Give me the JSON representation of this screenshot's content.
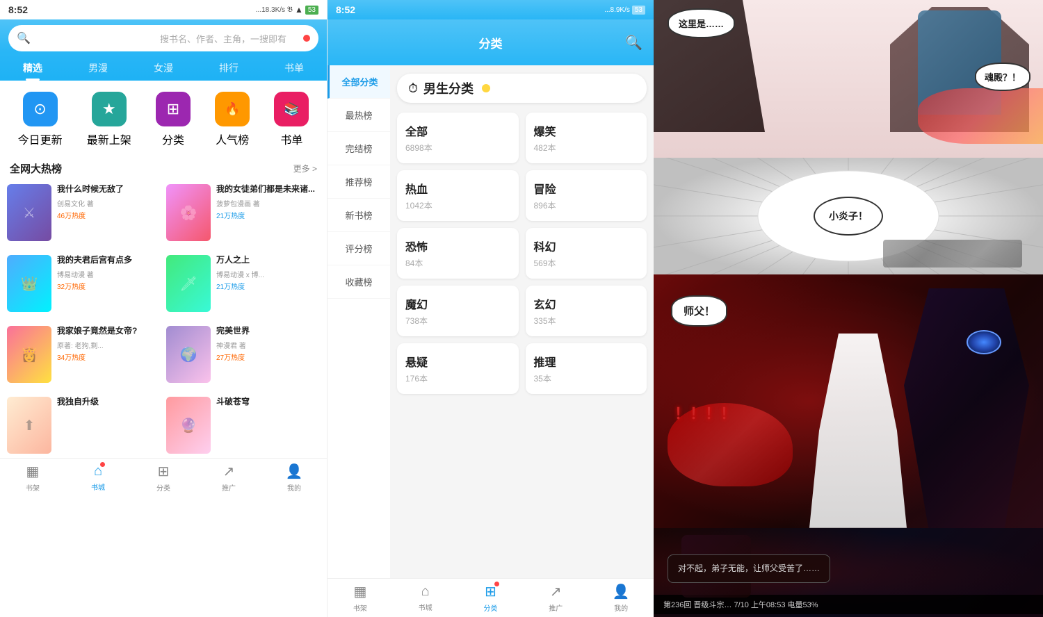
{
  "panel1": {
    "status": {
      "time": "8:52",
      "signal": "...18.3K/s",
      "battery": "53"
    },
    "search_placeholder": "搜书名、作者、主角，一搜即有",
    "nav_tabs": [
      "精选",
      "男漫",
      "女漫",
      "排行",
      "书单"
    ],
    "active_tab": "精选",
    "shortcuts": [
      {
        "label": "今日更新",
        "icon": "⊙",
        "color": "sc-blue"
      },
      {
        "label": "最新上架",
        "icon": "★",
        "color": "sc-teal"
      },
      {
        "label": "分类",
        "icon": "⊞",
        "color": "sc-purple"
      },
      {
        "label": "人气榜",
        "icon": "🔥",
        "color": "sc-orange"
      },
      {
        "label": "书单",
        "icon": "📚",
        "color": "sc-pink"
      }
    ],
    "section_title": "全网大热榜",
    "more_label": "更多 >",
    "books": [
      {
        "title": "我什么时候无敌了",
        "author": "创易文化 著",
        "heat": "46万热度",
        "cover_class": "cover-c1"
      },
      {
        "title": "我的女徒弟们都是未来诸...",
        "author": "菠萝包漫画 著",
        "heat": "21万热度",
        "cover_class": "cover-c2"
      },
      {
        "title": "我的夫君后宫有点多",
        "author": "博易动漫 著",
        "heat": "32万热度",
        "cover_class": "cover-c3"
      },
      {
        "title": "万人之上",
        "author": "博易动漫 x 博...",
        "heat": "21万热度",
        "cover_class": "cover-c4"
      },
      {
        "title": "我家娘子竟然是女帝?",
        "author": "原著: 老狗,剩...",
        "heat": "34万热度",
        "cover_class": "cover-c5"
      },
      {
        "title": "完美世界",
        "author": "神漫君 著",
        "heat": "27万热度",
        "cover_class": "cover-c6"
      },
      {
        "title": "我独自升级",
        "author": "",
        "heat": "",
        "cover_class": "cover-c7"
      },
      {
        "title": "斗破苍穹",
        "author": "",
        "heat": "",
        "cover_class": "cover-c8"
      }
    ],
    "bottom_nav": [
      {
        "label": "书架",
        "icon": "▦"
      },
      {
        "label": "书城",
        "icon": "⌂",
        "active": true,
        "badge": true
      },
      {
        "label": "分类",
        "icon": "⊞"
      },
      {
        "label": "推广",
        "icon": "↗"
      },
      {
        "label": "我的",
        "icon": "👤"
      }
    ]
  },
  "panel2": {
    "status": {
      "time": "8:52",
      "signal": "...8.9K/s",
      "battery": "53"
    },
    "title": "分类",
    "sidebar_items": [
      "全部分类",
      "最热榜",
      "完结榜",
      "推荐榜",
      "新书榜",
      "评分榜",
      "收藏榜"
    ],
    "active_sidebar": "全部分类",
    "category_title": "男生分类",
    "categories": [
      {
        "name": "全部",
        "count": "6898本"
      },
      {
        "name": "爆笑",
        "count": "482本"
      },
      {
        "name": "热血",
        "count": "1042本"
      },
      {
        "name": "冒险",
        "count": "896本"
      },
      {
        "name": "恐怖",
        "count": "84本"
      },
      {
        "name": "科幻",
        "count": "569本"
      },
      {
        "name": "魔幻",
        "count": "738本"
      },
      {
        "name": "玄幻",
        "count": "335本"
      },
      {
        "name": "悬疑",
        "count": "176本"
      },
      {
        "name": "推理",
        "count": "35本"
      }
    ],
    "bottom_nav": [
      {
        "label": "书架",
        "icon": "▦"
      },
      {
        "label": "书城",
        "icon": "⌂"
      },
      {
        "label": "分类",
        "icon": "⊞",
        "active": true,
        "badge": true
      },
      {
        "label": "推广",
        "icon": "↗"
      },
      {
        "label": "我的",
        "icon": "👤"
      }
    ]
  },
  "panel3": {
    "comic_panels": [
      {
        "speech": [
          "这里是……",
          "魂殿？！"
        ]
      },
      {
        "speech": [
          "小炎子！"
        ]
      },
      {
        "speech": [
          "师父！"
        ]
      },
      {
        "speech": [
          "对不起，弟子无能，让师父受苦了……"
        ]
      }
    ],
    "status_bar": "第236回 晋级斗宗… 7/10 上午08:53 电量53%"
  }
}
